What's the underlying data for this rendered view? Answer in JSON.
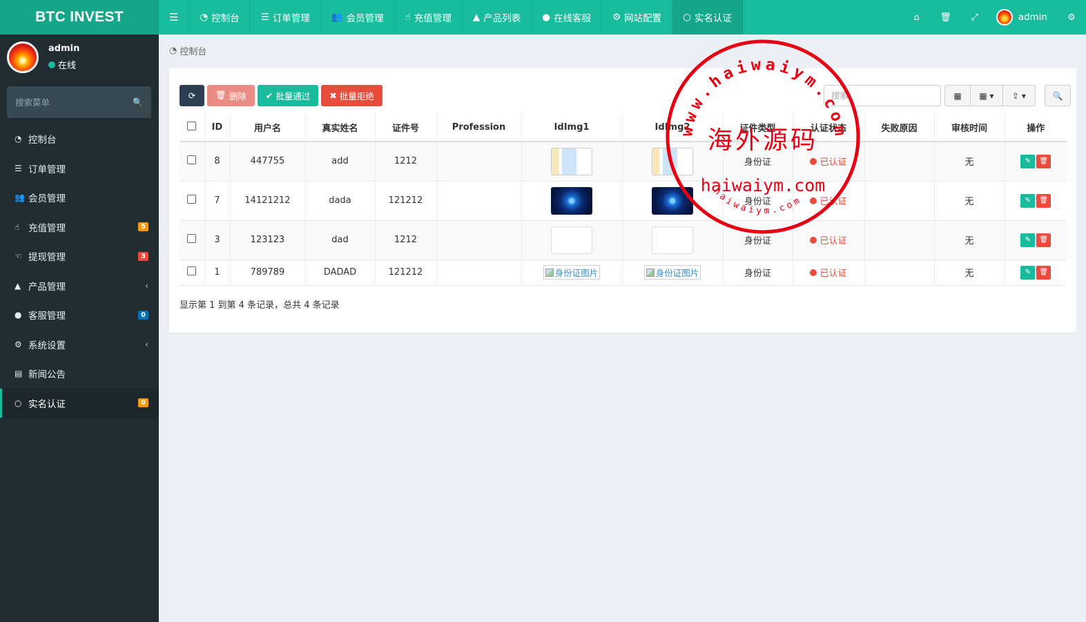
{
  "app": {
    "logo": "BTC INVEST"
  },
  "topnav": {
    "toggle_icon": "bars-icon",
    "items": [
      {
        "icon": "dashboard-icon",
        "label": "控制台",
        "active": false
      },
      {
        "icon": "list-icon",
        "label": "订单管理",
        "active": false
      },
      {
        "icon": "users-icon",
        "label": "会员管理",
        "active": false
      },
      {
        "icon": "hand-icon",
        "label": "充值管理",
        "active": false
      },
      {
        "icon": "bag-icon",
        "label": "产品列表",
        "active": false
      },
      {
        "icon": "chat-icon",
        "label": "在线客服",
        "active": false
      },
      {
        "icon": "gear-icon",
        "label": "网站配置",
        "active": false
      },
      {
        "icon": "circle-icon",
        "label": "实名认证",
        "active": true
      }
    ],
    "right": {
      "home_icon": "home-icon",
      "trash_icon": "trash-icon",
      "fullscreen_icon": "expand-icon",
      "user": "admin",
      "settings_icon": "gears-icon"
    }
  },
  "sidebar": {
    "user": {
      "name": "admin",
      "status": "在线"
    },
    "search_placeholder": "搜索菜单",
    "items": [
      {
        "icon": "dashboard-icon",
        "label": "控制台",
        "badge": "",
        "badge_color": "",
        "chevron": false,
        "active": false
      },
      {
        "icon": "list-icon",
        "label": "订单管理",
        "badge": "",
        "badge_color": "",
        "chevron": false,
        "active": false
      },
      {
        "icon": "users-icon",
        "label": "会员管理",
        "badge": "",
        "badge_color": "",
        "chevron": false,
        "active": false
      },
      {
        "icon": "hand-icon",
        "label": "充值管理",
        "badge": "5",
        "badge_color": "#f39c12",
        "chevron": false,
        "active": false
      },
      {
        "icon": "hand-left-icon",
        "label": "提现管理",
        "badge": "3",
        "badge_color": "#e74c3c",
        "chevron": false,
        "active": false
      },
      {
        "icon": "bag-icon",
        "label": "产品管理",
        "badge": "",
        "badge_color": "",
        "chevron": true,
        "active": false
      },
      {
        "icon": "chat-icon",
        "label": "客服管理",
        "badge": "0",
        "badge_color": "#0073b7",
        "chevron": false,
        "active": false
      },
      {
        "icon": "gears-icon",
        "label": "系统设置",
        "badge": "",
        "badge_color": "",
        "chevron": true,
        "active": false
      },
      {
        "icon": "newspaper-icon",
        "label": "新闻公告",
        "badge": "",
        "badge_color": "",
        "chevron": false,
        "active": false
      },
      {
        "icon": "circle-icon",
        "label": "实名认证",
        "badge": "0",
        "badge_color": "#f39c12",
        "chevron": false,
        "active": true
      }
    ]
  },
  "breadcrumb": {
    "icon": "dashboard-icon",
    "label": "控制台"
  },
  "toolbar": {
    "refresh_icon": "refresh-icon",
    "delete_label": "删除",
    "approve_label": "批量通过",
    "reject_label": "批量拒绝",
    "search_placeholder": "搜索",
    "table_toggle_icon": "table-icon",
    "columns_icon": "columns-icon",
    "export_icon": "export-icon",
    "search_icon": "search-icon"
  },
  "table": {
    "headers": [
      "ID",
      "用户名",
      "真实姓名",
      "证件号",
      "Profession",
      "IdImg1",
      "IdImg2",
      "证件类型",
      "认证状态",
      "失败原因",
      "审核时间",
      "操作"
    ],
    "rows": [
      {
        "id": "8",
        "username": "447755",
        "realname": "add",
        "idno": "1212",
        "profession": "",
        "img1": "doc",
        "img2": "doc",
        "idtype": "身份证",
        "status": "已认证",
        "reason": "",
        "time": "无"
      },
      {
        "id": "7",
        "username": "14121212",
        "realname": "dada",
        "idno": "121212",
        "profession": "",
        "img1": "tech",
        "img2": "tech",
        "idtype": "身份证",
        "status": "已认证",
        "reason": "",
        "time": "无"
      },
      {
        "id": "3",
        "username": "123123",
        "realname": "dad",
        "idno": "1212",
        "profession": "",
        "img1": "blank",
        "img2": "blank",
        "idtype": "身份证",
        "status": "已认证",
        "reason": "",
        "time": "无"
      },
      {
        "id": "1",
        "username": "789789",
        "realname": "DADAD",
        "idno": "121212",
        "profession": "",
        "img1": "broken",
        "img2": "broken",
        "idtype": "身份证",
        "status": "已认证",
        "reason": "",
        "time": "无"
      }
    ],
    "broken_img_alt": "身份证图片"
  },
  "pagination": {
    "info": "显示第 1 到第 4 条记录，总共 4 条记录"
  },
  "watermark": {
    "center": "海外源码",
    "middle": "haiwaiym.com",
    "arc_top": "www.haiwaiym.com",
    "arc_bottom": "haiwaiym.com"
  },
  "colors": {
    "primary": "#18bc9c",
    "sidebar": "#222d32",
    "danger": "#e74c3c",
    "stamp": "#e60012"
  }
}
